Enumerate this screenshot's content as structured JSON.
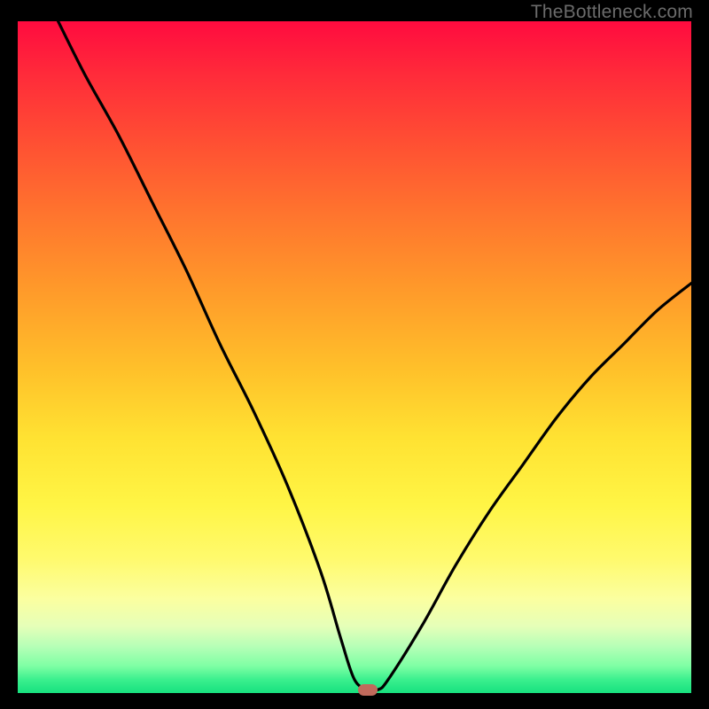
{
  "attribution": "TheBottleneck.com",
  "chart_data": {
    "type": "line",
    "title": "",
    "xlabel": "",
    "ylabel": "",
    "xlim": [
      0,
      100
    ],
    "ylim": [
      0,
      100
    ],
    "grid": false,
    "legend": false,
    "series": [
      {
        "name": "curve",
        "x": [
          6,
          10,
          15,
          20,
          25,
          30,
          35,
          40,
          45,
          48,
          50,
          52,
          53.5,
          55,
          60,
          65,
          70,
          75,
          80,
          85,
          90,
          95,
          100
        ],
        "y": [
          100,
          92,
          83,
          73,
          63,
          52,
          42,
          31,
          18,
          8,
          2,
          0.5,
          0.5,
          2,
          10,
          19,
          27,
          34,
          41,
          47,
          52,
          57,
          61
        ]
      }
    ],
    "annotations": [
      {
        "type": "marker",
        "shape": "pill",
        "color": "#c16a5c",
        "x": 52,
        "y": 0.5
      }
    ],
    "background_gradient": {
      "direction": "vertical",
      "stops": [
        {
          "pos": 0,
          "color": "#ff0b3f"
        },
        {
          "pos": 50,
          "color": "#ffc12a"
        },
        {
          "pos": 80,
          "color": "#fffa6d"
        },
        {
          "pos": 100,
          "color": "#17e07f"
        }
      ]
    }
  }
}
